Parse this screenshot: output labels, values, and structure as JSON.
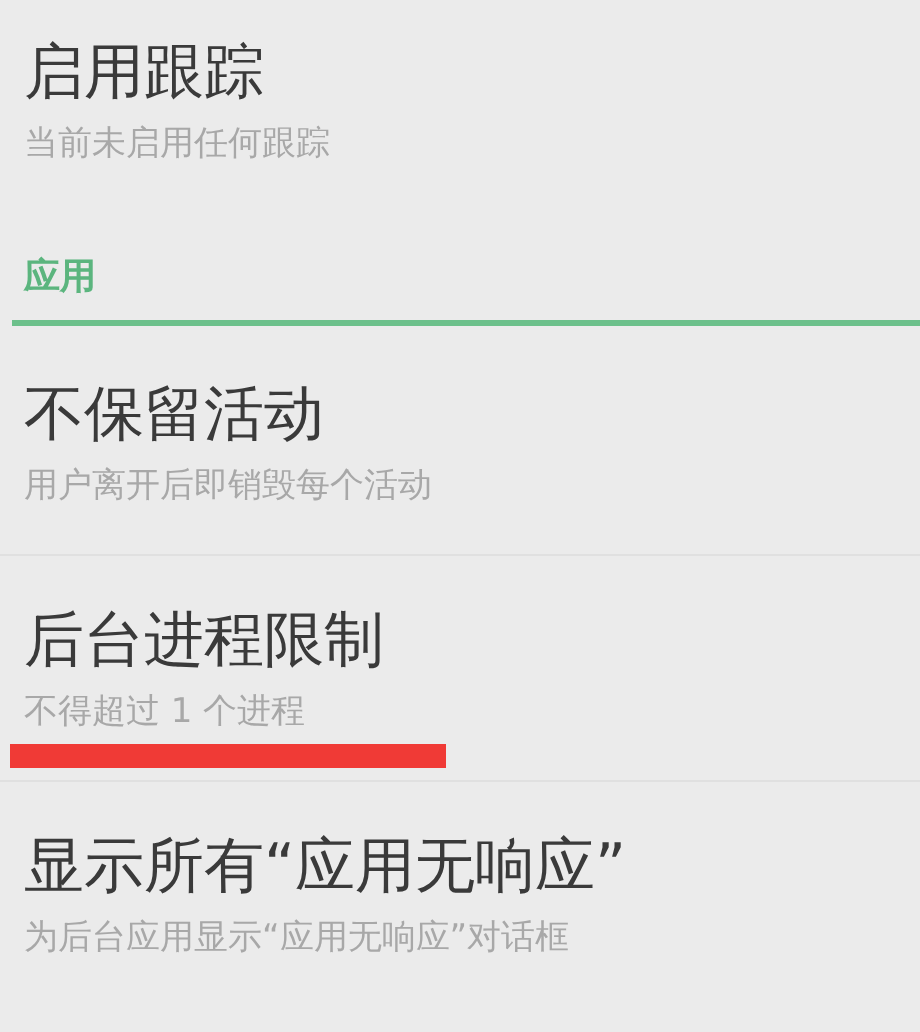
{
  "top_item": {
    "title": "启用跟踪",
    "summary": "当前未启用任何跟踪"
  },
  "section": {
    "header": "应用",
    "items": [
      {
        "title": "不保留活动",
        "summary": "用户离开后即销毁每个活动",
        "underlined": false
      },
      {
        "title": "后台进程限制",
        "summary": "不得超过 1 个进程",
        "underlined": true
      },
      {
        "title": "显示所有“应用无响应”",
        "summary": "为后台应用显示“应用无响应”对话框",
        "underlined": false
      }
    ]
  }
}
